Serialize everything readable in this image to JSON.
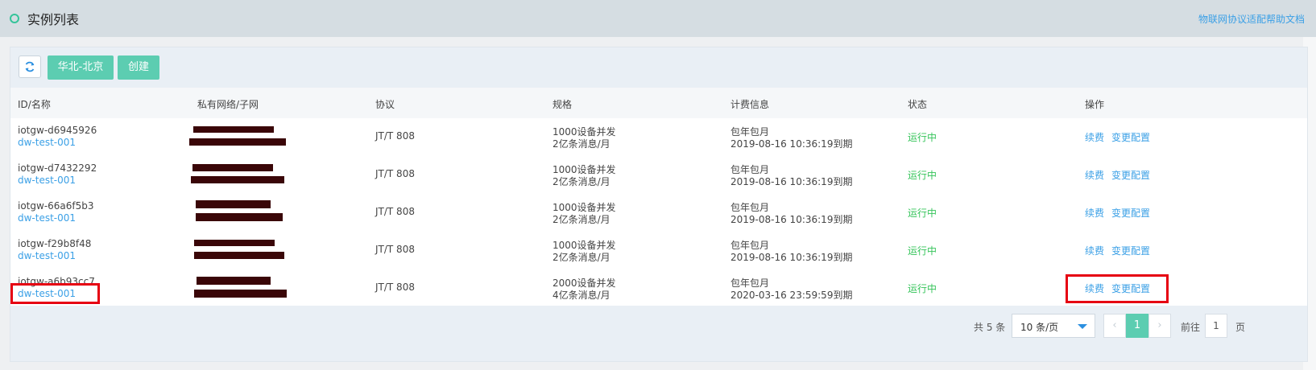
{
  "header": {
    "title": "实例列表",
    "help_link": "物联网协议适配帮助文档"
  },
  "toolbar": {
    "refresh_icon": "refresh-icon",
    "region_label": "华北-北京",
    "create_label": "创建"
  },
  "colors": {
    "accent": "#5ccdb1",
    "link": "#3ba0e6",
    "status_running": "#35c45a",
    "highlight": "#e60012"
  },
  "table": {
    "columns": [
      "ID/名称",
      "私有网络/子网",
      "协议",
      "规格",
      "计费信息",
      "状态",
      "操作"
    ],
    "rows": [
      {
        "id": "iotgw-d6945926",
        "name": "dw-test-001",
        "protocol": "JT/T 808",
        "spec1": "1000设备并发",
        "spec2": "2亿条消息/月",
        "billing1": "包年包月",
        "billing2": "2019-08-16 10:36:19到期",
        "status": "运行中",
        "action1": "续费",
        "action2": "变更配置"
      },
      {
        "id": "iotgw-d7432292",
        "name": "dw-test-001",
        "protocol": "JT/T 808",
        "spec1": "1000设备并发",
        "spec2": "2亿条消息/月",
        "billing1": "包年包月",
        "billing2": "2019-08-16 10:36:19到期",
        "status": "运行中",
        "action1": "续费",
        "action2": "变更配置"
      },
      {
        "id": "iotgw-66a6f5b3",
        "name": "dw-test-001",
        "protocol": "JT/T 808",
        "spec1": "1000设备并发",
        "spec2": "2亿条消息/月",
        "billing1": "包年包月",
        "billing2": "2019-08-16 10:36:19到期",
        "status": "运行中",
        "action1": "续费",
        "action2": "变更配置"
      },
      {
        "id": "iotgw-f29b8f48",
        "name": "dw-test-001",
        "protocol": "JT/T 808",
        "spec1": "1000设备并发",
        "spec2": "2亿条消息/月",
        "billing1": "包年包月",
        "billing2": "2019-08-16 10:36:19到期",
        "status": "运行中",
        "action1": "续费",
        "action2": "变更配置"
      },
      {
        "id": "iotgw-a6b93cc7",
        "name": "dw-test-001",
        "protocol": "JT/T 808",
        "spec1": "2000设备并发",
        "spec2": "4亿条消息/月",
        "billing1": "包年包月",
        "billing2": "2020-03-16 23:59:59到期",
        "status": "运行中",
        "action1": "续费",
        "action2": "变更配置"
      }
    ]
  },
  "pagination": {
    "total": "共 5 条",
    "page_size": "10 条/页",
    "current_page": "1",
    "goto_label": "前往",
    "goto_value": "1",
    "page_suffix": "页"
  }
}
